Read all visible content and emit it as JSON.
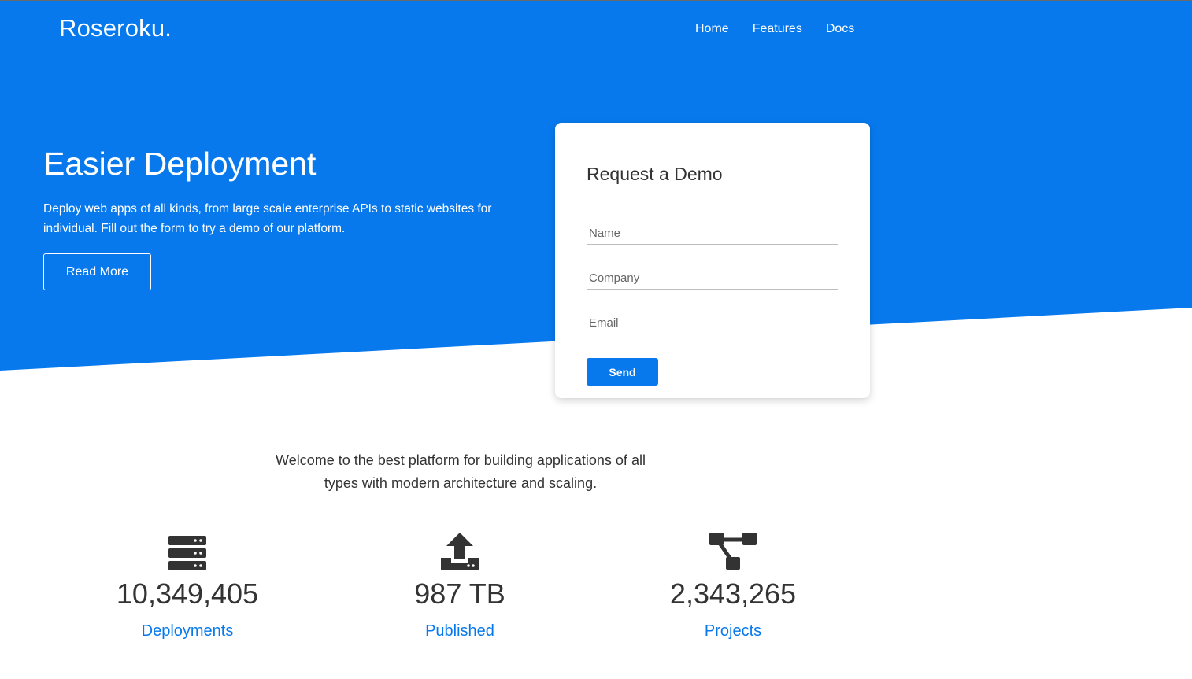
{
  "theme": {
    "primary": "#0779ed",
    "text": "#333333",
    "white": "#ffffff"
  },
  "header": {
    "brand": "Roseroku.",
    "nav": [
      "Home",
      "Features",
      "Docs"
    ]
  },
  "hero": {
    "title": "Easier Deployment",
    "text": "Deploy web apps of all kinds, from large scale enterprise APIs to static websites for individual. Fill out the form to try a demo of our platform.",
    "button": "Read More"
  },
  "form": {
    "title": "Request a Demo",
    "fields": [
      {
        "placeholder": "Name",
        "value": ""
      },
      {
        "placeholder": "Company",
        "value": ""
      },
      {
        "placeholder": "Email",
        "value": ""
      }
    ],
    "submit": "Send"
  },
  "welcome": "Welcome to the best platform for building applications of all types with modern architecture and scaling.",
  "stats": [
    {
      "icon": "server-icon",
      "value": "10,349,405",
      "label": "Deployments"
    },
    {
      "icon": "upload-icon",
      "value": "987 TB",
      "label": "Published"
    },
    {
      "icon": "project-diagram-icon",
      "value": "2,343,265",
      "label": "Projects"
    }
  ]
}
